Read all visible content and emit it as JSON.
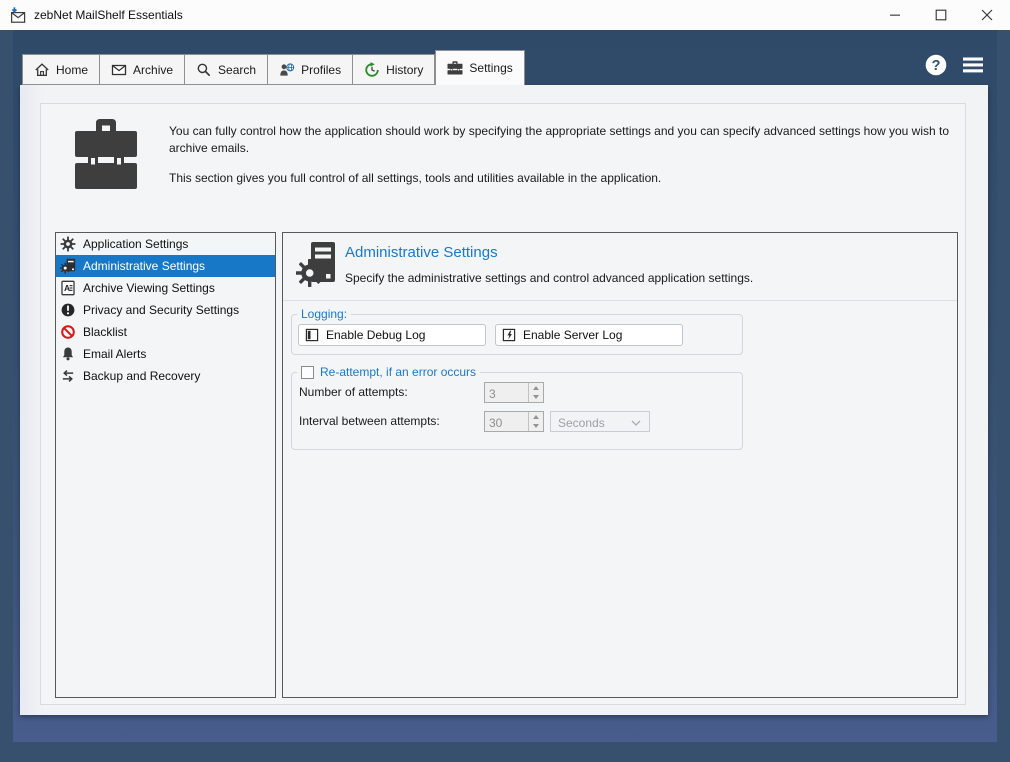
{
  "window": {
    "title": "zebNet MailShelf Essentials",
    "controls": [
      {
        "icon": "minimize-icon"
      },
      {
        "icon": "maximize-icon"
      },
      {
        "icon": "close-icon"
      }
    ]
  },
  "tabs": [
    {
      "label": "Home",
      "icon": "home-icon",
      "active": false
    },
    {
      "label": "Archive",
      "icon": "envelope-icon",
      "active": false
    },
    {
      "label": "Search",
      "icon": "search-icon",
      "active": false
    },
    {
      "label": "Profiles",
      "icon": "profiles-icon",
      "active": false
    },
    {
      "label": "History",
      "icon": "history-icon",
      "active": false
    },
    {
      "label": "Settings",
      "icon": "toolbox-icon",
      "active": true
    }
  ],
  "top_actions": [
    {
      "icon": "help-icon"
    },
    {
      "icon": "menu-icon"
    }
  ],
  "intro": {
    "p1": "You can fully control how the application should work by specifying the appropriate settings and you can specify advanced settings how you wish to archive emails.",
    "p2": "This section gives you full control of all settings, tools and utilities available in the application."
  },
  "sidebar": {
    "items": [
      {
        "label": "Application Settings",
        "icon": "gear-icon",
        "selected": false
      },
      {
        "label": "Administrative Settings",
        "icon": "admin-gear-document-icon",
        "selected": true
      },
      {
        "label": "Archive Viewing Settings",
        "icon": "archive-viewing-icon",
        "selected": false
      },
      {
        "label": "Privacy and Security Settings",
        "icon": "exclamation-circle-icon",
        "selected": false
      },
      {
        "label": "Blacklist",
        "icon": "blocked-icon",
        "selected": false
      },
      {
        "label": "Email Alerts",
        "icon": "bell-icon",
        "selected": false
      },
      {
        "label": "Backup and Recovery",
        "icon": "swap-arrows-icon",
        "selected": false
      }
    ]
  },
  "panel": {
    "title": "Administrative Settings",
    "subtitle": "Specify the administrative settings and control advanced application settings.",
    "logging": {
      "legend": "Logging:",
      "buttons": [
        {
          "label": "Enable Debug Log",
          "icon": "debug-log-icon"
        },
        {
          "label": "Enable Server Log",
          "icon": "server-log-icon"
        }
      ]
    },
    "reattempt": {
      "legend": "Re-attempt, if an error occurs",
      "checked": false,
      "rows": [
        {
          "label": "Number of attempts:",
          "value": "3"
        },
        {
          "label": "Interval between attempts:",
          "value": "30",
          "unit": "Seconds"
        }
      ]
    }
  },
  "colors": {
    "accent_blue": "#1979CA",
    "selection_blue": "#1878C8",
    "navy_frame": "#36506D",
    "navy_gradient_bottom": "#4A5E90",
    "panel_bg": "#F4F5F7",
    "blacklist_red": "#D21818",
    "history_green": "#2E8B2E",
    "icon_dark": "#3E3E3E"
  }
}
